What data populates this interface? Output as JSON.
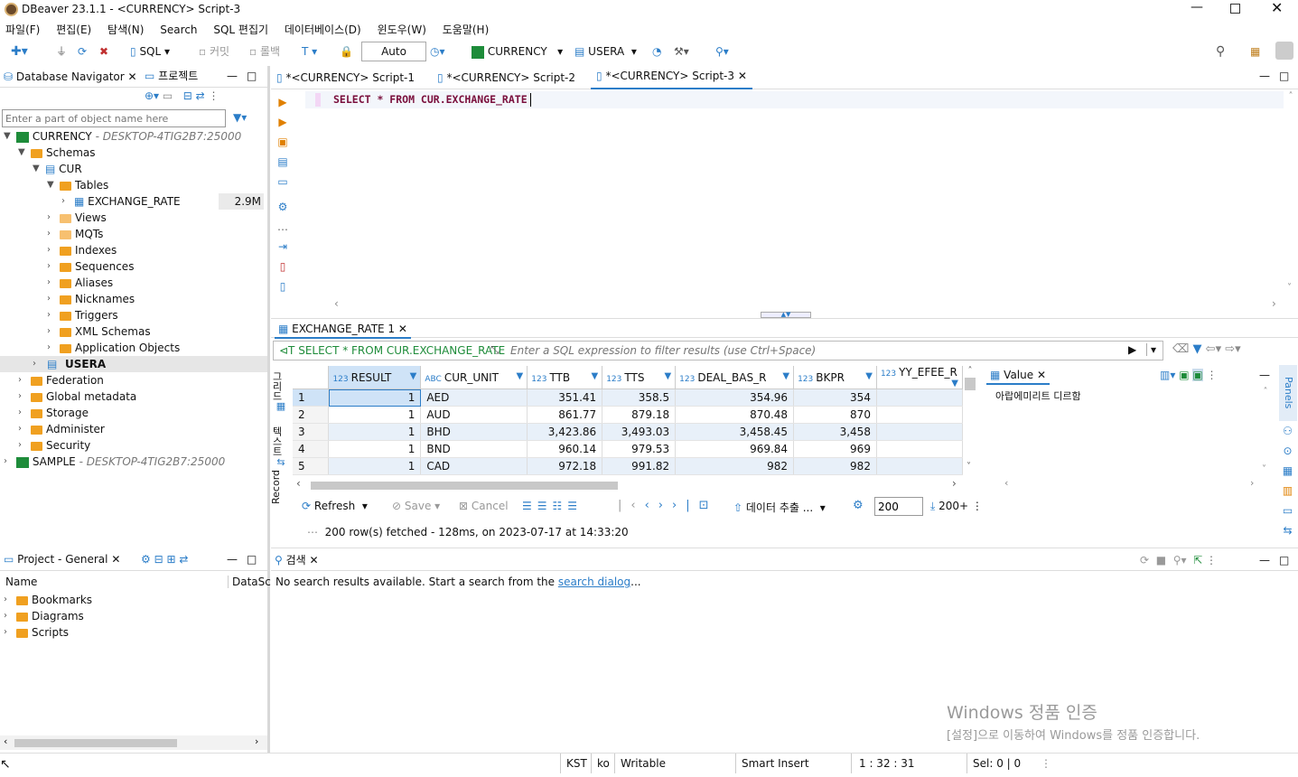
{
  "window": {
    "title": "DBeaver 23.1.1 - <CURRENCY> Script-3"
  },
  "menu": [
    "파일(F)",
    "편집(E)",
    "탐색(N)",
    "Search",
    "SQL 편집기",
    "데이터베이스(D)",
    "윈도우(W)",
    "도움말(H)"
  ],
  "toolbar": {
    "sql_label": "SQL",
    "commit_label": "커밋",
    "rollback_label": "롤백",
    "auto_value": "Auto",
    "datasource": "CURRENCY",
    "schema": "USERA"
  },
  "navigator": {
    "tab_label": "Database Navigator",
    "tab2_label": "프로젝트",
    "filter_placeholder": "Enter a part of object name here",
    "conn1": "CURRENCY",
    "conn1_host": "- DESKTOP-4TIG2B7:25000",
    "schemas": "Schemas",
    "cur": "CUR",
    "tables": "Tables",
    "table1": "EXCHANGE_RATE",
    "table1_size": "2.9M",
    "cur_children": [
      "Views",
      "MQTs",
      "Indexes",
      "Sequences",
      "Aliases",
      "Nicknames",
      "Triggers",
      "XML Schemas",
      "Application Objects"
    ],
    "usera": "USERA",
    "conn1_children": [
      "Federation",
      "Global metadata",
      "Storage",
      "Administer",
      "Security"
    ],
    "conn2": "SAMPLE",
    "conn2_host": "- DESKTOP-4TIG2B7:25000"
  },
  "project": {
    "tab_label": "Project - General",
    "col_name": "Name",
    "col_ds": "DataSc",
    "items": [
      "Bookmarks",
      "Diagrams",
      "Scripts"
    ]
  },
  "editor": {
    "tabs": [
      "*<CURRENCY> Script-1",
      "*<CURRENCY> Script-2",
      "*<CURRENCY> Script-3"
    ],
    "sql": "SELECT * FROM CUR.EXCHANGE_RATE"
  },
  "results": {
    "tab_label": "EXCHANGE_RATE 1",
    "query": "SELECT * FROM CUR.EXCHANGE_RATE",
    "filter_placeholder": "Enter a SQL expression to filter results (use Ctrl+Space)",
    "side_labels": [
      "그리드",
      "텍스트"
    ],
    "record_label": "Record",
    "columns": [
      {
        "type": "123",
        "name": "RESULT"
      },
      {
        "type": "ABC",
        "name": "CUR_UNIT"
      },
      {
        "type": "123",
        "name": "TTB"
      },
      {
        "type": "123",
        "name": "TTS"
      },
      {
        "type": "123",
        "name": "DEAL_BAS_R"
      },
      {
        "type": "123",
        "name": "BKPR"
      },
      {
        "type": "123",
        "name": "YY_EFEE_R"
      }
    ],
    "rows": [
      [
        "1",
        "1",
        "AED",
        "351.41",
        "358.5",
        "354.96",
        "354"
      ],
      [
        "2",
        "1",
        "AUD",
        "861.77",
        "879.18",
        "870.48",
        "870"
      ],
      [
        "3",
        "1",
        "BHD",
        "3,423.86",
        "3,493.03",
        "3,458.45",
        "3,458"
      ],
      [
        "4",
        "1",
        "BND",
        "960.14",
        "979.53",
        "969.84",
        "969"
      ],
      [
        "5",
        "1",
        "CAD",
        "972.18",
        "991.82",
        "982",
        "982"
      ]
    ],
    "refresh_label": "Refresh",
    "save_label": "Save",
    "cancel_label": "Cancel",
    "export_label": "데이터 추출 ...",
    "fetch_size": "200",
    "fetch_all": "200+",
    "status": "200 row(s) fetched - 128ms, on 2023-07-17 at 14:33:20"
  },
  "value_panel": {
    "tab_label": "Value",
    "content": "아랍에미리트 디르함",
    "side_label": "Panels"
  },
  "search": {
    "tab_label": "검색",
    "message": "No search results available. Start a search from the ",
    "link": "search dialog",
    "suffix": "..."
  },
  "watermark": {
    "line1": "Windows 정품 인증",
    "line2": "[설정]으로 이동하여 Windows를 정품 인증합니다."
  },
  "statusbar": {
    "tz": "KST",
    "lang": "ko",
    "mode": "Writable",
    "insert": "Smart Insert",
    "pos": "1 : 32 : 31",
    "sel": "Sel: 0 | 0"
  },
  "colors": {
    "accent": "#2b7dc8",
    "selection": "#cfe3f7",
    "folder": "#f0a020",
    "db_green": "#1e8c3a"
  }
}
